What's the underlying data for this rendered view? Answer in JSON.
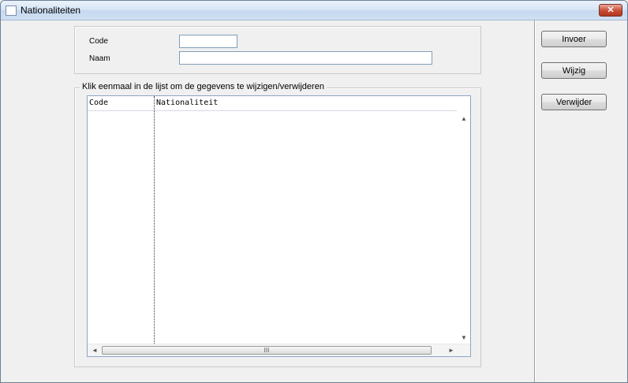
{
  "window": {
    "title": "Nationaliteiten",
    "close_glyph": "✕"
  },
  "form": {
    "code_label": "Code",
    "code_value": "",
    "naam_label": "Naam",
    "naam_value": ""
  },
  "list": {
    "group_title": "Klik eenmaal in de lijst om de gegevens te wijzigen/verwijderen",
    "columns": [
      "Code",
      "Nationaliteit"
    ],
    "rows": [],
    "scroll": {
      "up": "▲",
      "down": "▼",
      "left": "◄",
      "right": "►",
      "grip": "III"
    }
  },
  "buttons": {
    "invoer": "Invoer",
    "wijzig": "Wijzig",
    "verwijder": "Verwijder"
  },
  "icons": {
    "app": "window-icon",
    "close": "close-icon"
  }
}
